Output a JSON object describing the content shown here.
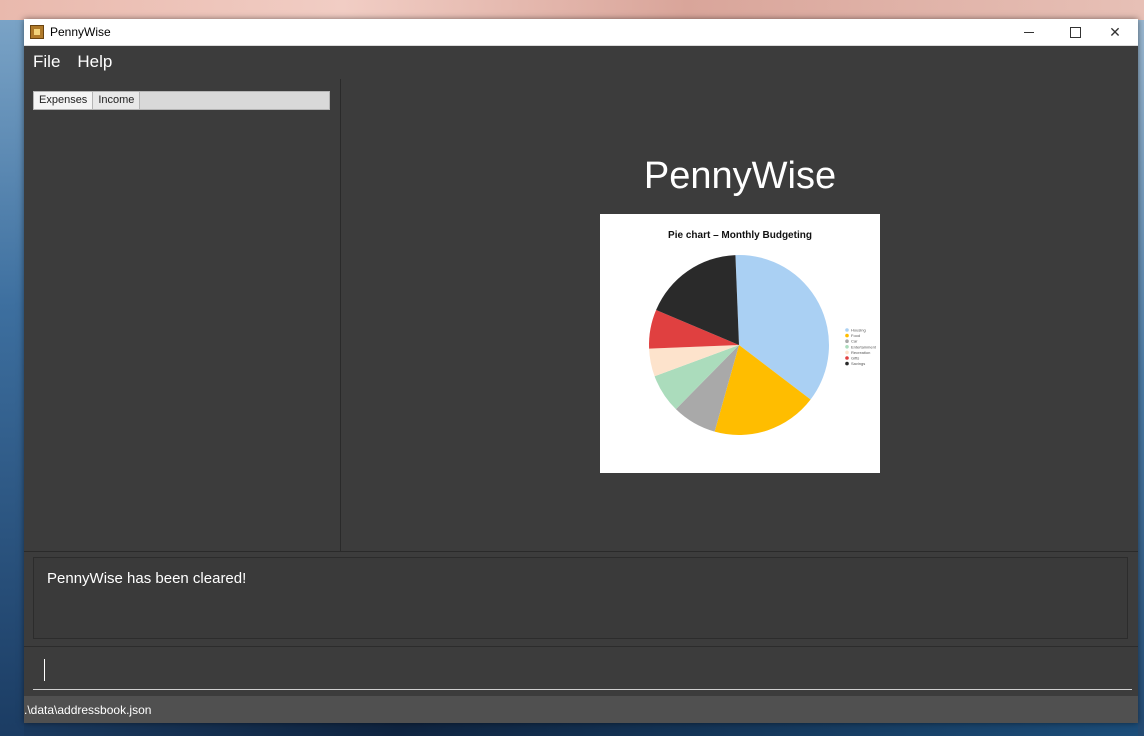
{
  "window": {
    "title": "PennyWise"
  },
  "menu": {
    "items": [
      "File",
      "Help"
    ]
  },
  "tabs": [
    {
      "label": "Expenses"
    },
    {
      "label": "Income"
    }
  ],
  "main": {
    "heading": "PennyWise"
  },
  "chart_data": {
    "type": "pie",
    "title": "Pie chart – Monthly Budgeting",
    "legend_position": "right",
    "categories": [
      "Housing",
      "Food",
      "Car",
      "Entertainment",
      "Recreation",
      "Gifts",
      "Savings"
    ],
    "values": [
      36,
      19,
      8,
      7,
      5,
      7,
      18
    ],
    "colors": [
      "#aad0f3",
      "#ffbd00",
      "#a9a9a9",
      "#abdcbc",
      "#fde3cc",
      "#e04040",
      "#2a2a2a"
    ]
  },
  "result": {
    "message": "PennyWise has been cleared!"
  },
  "command": {
    "value": ""
  },
  "status": {
    "path": ".\\data\\addressbook.json"
  }
}
